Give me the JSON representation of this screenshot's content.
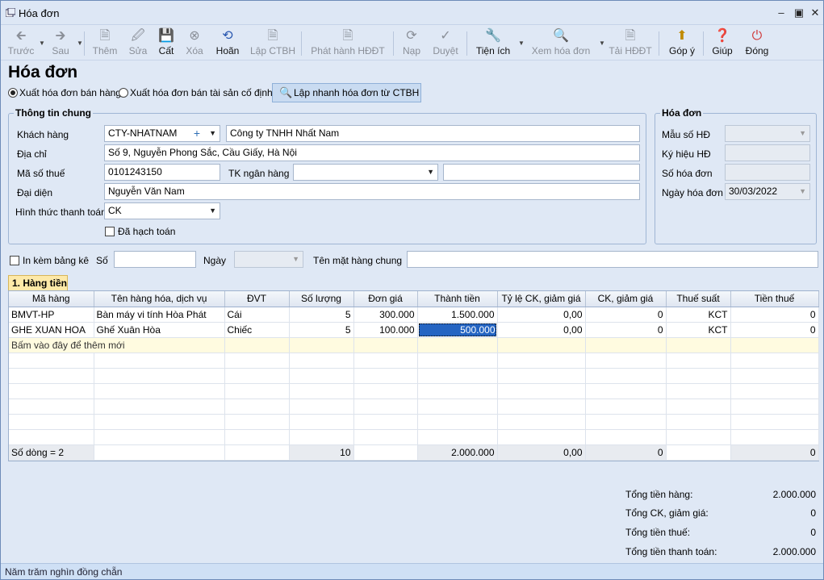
{
  "window": {
    "title": "Hóa đơn"
  },
  "toolbar": [
    {
      "label": "Trước",
      "icon": "arrow-left-icon",
      "enabled": false
    },
    {
      "label": "Sau",
      "icon": "arrow-right-icon",
      "enabled": false
    },
    {
      "label": "Thêm",
      "icon": "add-doc-icon",
      "enabled": false
    },
    {
      "label": "Sửa",
      "icon": "edit-icon",
      "enabled": false
    },
    {
      "label": "Cất",
      "icon": "save-icon",
      "enabled": true
    },
    {
      "label": "Xóa",
      "icon": "delete-icon",
      "enabled": false
    },
    {
      "label": "Hoãn",
      "icon": "undo-icon",
      "enabled": true
    },
    {
      "label": "Lập CTBH",
      "icon": "create-doc-icon",
      "enabled": false
    },
    {
      "label": "Phát hành HĐĐT",
      "icon": "publish-icon",
      "enabled": false
    },
    {
      "label": "Nạp",
      "icon": "refresh-icon",
      "enabled": false
    },
    {
      "label": "Duyệt",
      "icon": "check-icon",
      "enabled": false
    },
    {
      "label": "Tiện ích",
      "icon": "tools-icon",
      "enabled": true
    },
    {
      "label": "Xem hóa đơn",
      "icon": "preview-icon",
      "enabled": false
    },
    {
      "label": "Tải HĐĐT",
      "icon": "download-icon",
      "enabled": false
    },
    {
      "label": "Góp ý",
      "icon": "feedback-icon",
      "enabled": true
    },
    {
      "label": "Giúp",
      "icon": "help-icon",
      "enabled": true
    },
    {
      "label": "Đóng",
      "icon": "power-icon",
      "enabled": true
    }
  ],
  "page": {
    "heading": "Hóa đơn",
    "radio_sales": "Xuất hóa đơn bán hàng",
    "radio_assets": "Xuất hóa đơn bán tài sản cố định",
    "quick_button": "Lập nhanh hóa đơn từ CTBH"
  },
  "general": {
    "legend": "Thông tin chung",
    "customer_label": "Khách hàng",
    "customer_code": "CTY-NHATNAM",
    "customer_name": "Công ty TNHH Nhất Nam",
    "address_label": "Địa chỉ",
    "address": "Số 9, Nguyễn Phong Sắc, Cầu Giấy, Hà Nội",
    "tax_label": "Mã số thuế",
    "tax_code": "0101243150",
    "bank_label": "TK ngân hàng",
    "bank_account": "",
    "bank_name": "",
    "rep_label": "Đại diện",
    "representative": "Nguyễn Văn Nam",
    "payment_label": "Hình thức thanh toán",
    "payment_method": "CK",
    "posted_label": "Đã hạch toán"
  },
  "invoice": {
    "legend": "Hóa đơn",
    "template_label": "Mẫu số HĐ",
    "template": "",
    "symbol_label": "Ký hiệu HĐ",
    "symbol": "",
    "number_label": "Số hóa đơn",
    "number": "",
    "date_label": "Ngày hóa đơn",
    "date": "30/03/2022"
  },
  "attach": {
    "print_label": "In kèm bảng kê",
    "no_label": "Số",
    "no_value": "",
    "date_label": "Ngày",
    "date_value": "",
    "common_label": "Tên mặt hàng chung",
    "common_value": ""
  },
  "tab": {
    "label": "1. Hàng tiền"
  },
  "table": {
    "columns": [
      "Mã hàng",
      "Tên hàng hóa, dịch vụ",
      "ĐVT",
      "Số lượng",
      "Đơn giá",
      "Thành tiền",
      "Tỷ lệ CK, giảm giá",
      "CK, giảm giá",
      "Thuế suất",
      "Tiền thuế"
    ],
    "rows": [
      [
        "BMVT-HP",
        "Bàn máy vi tính Hòa Phát",
        "Cái",
        "5",
        "300.000",
        "1.500.000",
        "0,00",
        "0",
        "KCT",
        "0"
      ],
      [
        "GHE XUAN HOA",
        "Ghế Xuân Hòa",
        "Chiếc",
        "5",
        "100.000",
        "500.000",
        "0,00",
        "0",
        "KCT",
        "0"
      ]
    ],
    "add_new": "Bấm vào đây để thêm mới",
    "summary": [
      "Số dòng = 2",
      "",
      "",
      "10",
      "",
      "2.000.000",
      "0,00",
      "0",
      "",
      "0"
    ]
  },
  "totals": {
    "goods_label": "Tổng tiền hàng:",
    "goods": "2.000.000",
    "discount_label": "Tổng CK, giảm giá:",
    "discount": "0",
    "tax_label": "Tổng tiền thuế:",
    "tax": "0",
    "payment_label": "Tổng tiền thanh toán:",
    "payment": "2.000.000"
  },
  "status": {
    "text": "Năm trăm nghìn đồng chẵn"
  }
}
